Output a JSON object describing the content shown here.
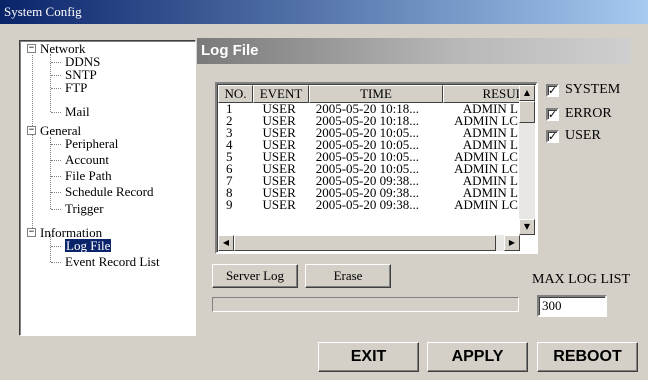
{
  "window": {
    "title": "System Config"
  },
  "tree": {
    "network": {
      "label": "Network",
      "toggle": "−",
      "children": [
        "DDNS",
        "SNTP",
        "FTP",
        "Mail"
      ]
    },
    "general": {
      "label": "General",
      "toggle": "−",
      "children": [
        "Peripheral",
        "Account",
        "File Path",
        "Schedule Record",
        "Trigger"
      ]
    },
    "information": {
      "label": "Information",
      "toggle": "−",
      "children": [
        "Log File",
        "Event Record List"
      ]
    }
  },
  "panel": {
    "title": "Log File"
  },
  "log_table": {
    "columns": [
      "NO.",
      "EVENT",
      "TIME",
      "RESUI"
    ],
    "rows": [
      [
        "1",
        "USER",
        "2005-05-20 10:18...",
        "ADMIN L"
      ],
      [
        "2",
        "USER",
        "2005-05-20 10:18...",
        "ADMIN LC"
      ],
      [
        "3",
        "USER",
        "2005-05-20 10:05...",
        "ADMIN L"
      ],
      [
        "4",
        "USER",
        "2005-05-20 10:05...",
        "ADMIN L"
      ],
      [
        "5",
        "USER",
        "2005-05-20 10:05...",
        "ADMIN LC"
      ],
      [
        "6",
        "USER",
        "2005-05-20 10:05...",
        "ADMIN LC"
      ],
      [
        "7",
        "USER",
        "2005-05-20 09:38...",
        "ADMIN L"
      ],
      [
        "8",
        "USER",
        "2005-05-20 09:38...",
        "ADMIN L"
      ],
      [
        "9",
        "USER",
        "2005-05-20 09:38...",
        "ADMIN LC"
      ]
    ]
  },
  "filters": [
    {
      "label": "SYSTEM",
      "checked": true
    },
    {
      "label": "ERROR",
      "checked": true
    },
    {
      "label": "USER",
      "checked": true
    }
  ],
  "check_mark": "✓",
  "arrows": {
    "up": "▲",
    "down": "▼",
    "left": "◀",
    "right": "▶"
  },
  "buttons": {
    "server_log": "Server Log",
    "erase": "Erase",
    "exit": "EXIT",
    "apply": "APPLY",
    "reboot": "REBOOT"
  },
  "max_log": {
    "label": "MAX LOG LIST",
    "value": "300"
  },
  "colors": {
    "title_start": "#0a246a",
    "title_end": "#a6caf0",
    "selection": "#0a246a",
    "face": "#d4d0c8"
  }
}
